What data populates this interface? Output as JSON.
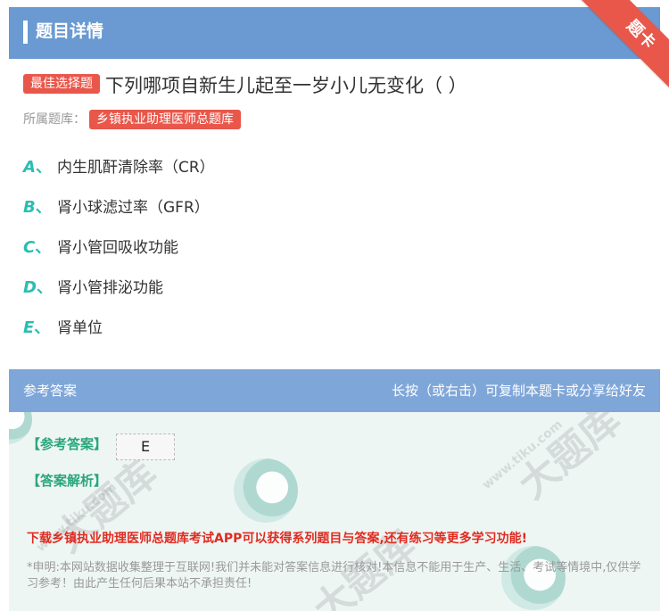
{
  "header": {
    "title": "题目详情",
    "corner_badge": "题卡"
  },
  "question": {
    "type_label": "最佳选择题",
    "text": "下列哪项自新生儿起至一岁小儿无变化（ ）",
    "bank_label": "所属题库：",
    "bank_name": "乡镇执业助理医师总题库"
  },
  "options": [
    {
      "letter": "A",
      "sep": "、",
      "text": "内生肌酐清除率（CR）"
    },
    {
      "letter": "B",
      "sep": "、",
      "text": "肾小球滤过率（GFR）"
    },
    {
      "letter": "C",
      "sep": "、",
      "text": "肾小管回吸收功能"
    },
    {
      "letter": "D",
      "sep": "、",
      "text": "肾小管排泌功能"
    },
    {
      "letter": "E",
      "sep": "、",
      "text": "肾单位"
    }
  ],
  "answer": {
    "section_title": "参考答案",
    "hint": "长按（或右击）可复制本题卡或分享给好友",
    "answer_label": "【参考答案】",
    "answer_value": "E",
    "analysis_label": "【答案解析】",
    "download_text": "下载乡镇执业助理医师总题库考试APP可以获得系列题目与答案,还有练习等更多学习功能!",
    "disclaimer": "*申明:本网站数据收集整理于互联网!我们并未能对答案信息进行核对!本信息不能用于生产、生活、考试等情境中,仅供学习参考！由此产生任何后果本站不承担责任!"
  },
  "watermark": {
    "text": "大题库",
    "url": "www.tiku.com"
  },
  "colors": {
    "header_bg": "#6a9ad1",
    "accent_red": "#e9574b",
    "option_letter": "#2bbdb3",
    "answer_green": "#2aa67a"
  }
}
